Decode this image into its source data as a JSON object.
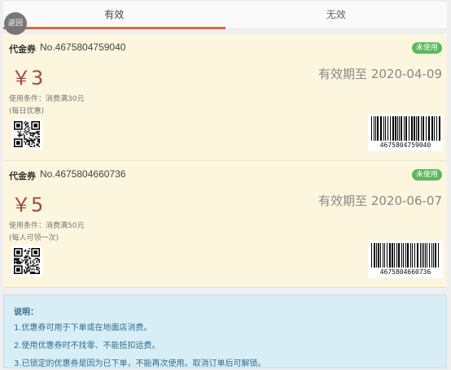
{
  "tabs": {
    "valid": "有效",
    "invalid": "无效"
  },
  "back_label": "返回",
  "coupons": [
    {
      "type": "代金券",
      "number": "No.4675804759040",
      "status": "未使用",
      "amount": "￥3",
      "expiry": "有效期至 2020-04-09",
      "condition": "使用条件：消费满30元",
      "note": "(每日优惠)",
      "barcode": "4675804759040"
    },
    {
      "type": "代金券",
      "number": "No.4675804660736",
      "status": "未使用",
      "amount": "￥5",
      "expiry": "有效期至 2020-06-07",
      "condition": "使用条件：消费满50元",
      "note": "(每人可领一次)",
      "barcode": "4675804660736"
    }
  ],
  "notes": {
    "title": "说明：",
    "lines": [
      "1.优惠券可用于下单或在地面店消费。",
      "2.使用优惠券时不找零、不能抵扣运费。",
      "3.已锁定的优惠券是因为已下单，不能再次使用。取消订单后可解锁。"
    ]
  },
  "colors": {
    "accent": "#d56b3c",
    "badge": "#5cb85c",
    "amount": "#a34a3c",
    "coupon_bg": "#fcf6de",
    "notes_bg": "#d8eef7"
  }
}
